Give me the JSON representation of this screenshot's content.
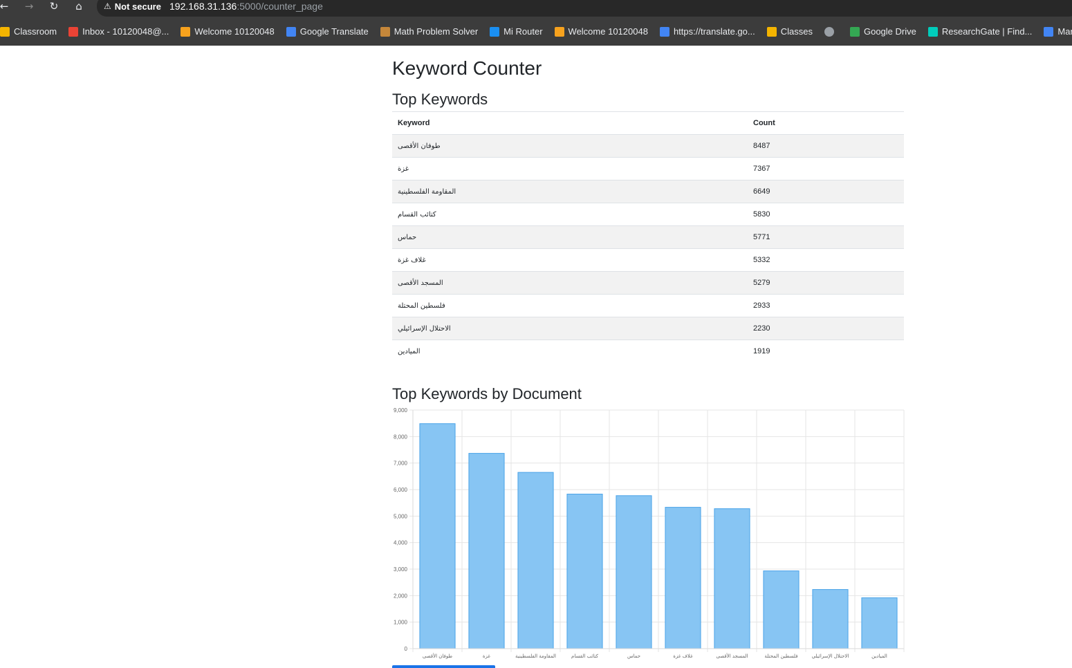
{
  "browser": {
    "security_label": "Not secure",
    "url_host": "192.168.31.136",
    "url_rest": ":5000/counter_page",
    "bookmarks": [
      {
        "label": "Classroom",
        "icon": "google-classroom-icon",
        "color": "#f4b400"
      },
      {
        "label": "Inbox - 10120048@...",
        "icon": "gmail-icon",
        "color": "#ea4335"
      },
      {
        "label": "Welcome 10120048",
        "icon": "moodle-icon",
        "color": "#f7a21d"
      },
      {
        "label": "Google Translate",
        "icon": "google-translate-icon",
        "color": "#4285f4"
      },
      {
        "label": "Math Problem Solver",
        "icon": "math-solver-icon",
        "color": "#c5873a"
      },
      {
        "label": "Mi Router",
        "icon": "wifi-icon",
        "color": "#1a8ff2"
      },
      {
        "label": "Welcome 10120048",
        "icon": "moodle-icon",
        "color": "#f7a21d"
      },
      {
        "label": "https://translate.go...",
        "icon": "google-translate-icon",
        "color": "#4285f4"
      },
      {
        "label": "Classes",
        "icon": "google-classroom-icon",
        "color": "#f4b400"
      },
      {
        "label": "",
        "icon": "globe-icon",
        "color": "#9aa0a6"
      },
      {
        "label": "Google Drive",
        "icon": "google-drive-icon",
        "color": "#34a853"
      },
      {
        "label": "ResearchGate | Find...",
        "icon": "researchgate-icon",
        "color": "#00ccbb"
      },
      {
        "label": "Managing diversity",
        "icon": "google-docs-icon",
        "color": "#4285f4"
      }
    ]
  },
  "page": {
    "title": "Keyword Counter",
    "table_heading": "Top Keywords",
    "chart_heading": "Top Keywords by Document"
  },
  "table": {
    "headers": [
      "Keyword",
      "Count"
    ],
    "rows": [
      [
        "طوفان الأقصى",
        "8487"
      ],
      [
        "غزة",
        "7367"
      ],
      [
        "المقاومة الفلسطينية",
        "6649"
      ],
      [
        "كتائب القسام",
        "5830"
      ],
      [
        "حماس",
        "5771"
      ],
      [
        "غلاف غزة",
        "5332"
      ],
      [
        "المسجد الأقصى",
        "5279"
      ],
      [
        "فلسطين المحتلة",
        "2933"
      ],
      [
        "الاحتلال الإسرائيلي",
        "2230"
      ],
      [
        "الميادين",
        "1919"
      ]
    ]
  },
  "chart_data": {
    "type": "bar",
    "categories": [
      "طوفان الأقصى",
      "غزة",
      "المقاومة الفلسطينية",
      "كتائب القسام",
      "حماس",
      "غلاف غزة",
      "المسجد الأقصى",
      "فلسطين المحتلة",
      "الاحتلال الإسرائيلي",
      "الميادين"
    ],
    "values": [
      8487,
      7367,
      6649,
      5830,
      5771,
      5332,
      5279,
      2933,
      2230,
      1919
    ],
    "ylim": [
      0,
      9000
    ],
    "yticks": [
      "0",
      "1,000",
      "2,000",
      "3,000",
      "4,000",
      "5,000",
      "6,000",
      "7,000",
      "8,000",
      "9,000"
    ],
    "grid": true,
    "legend": "none",
    "bar_color": "#87c5f3",
    "bar_border_color": "#4aa3e8"
  }
}
